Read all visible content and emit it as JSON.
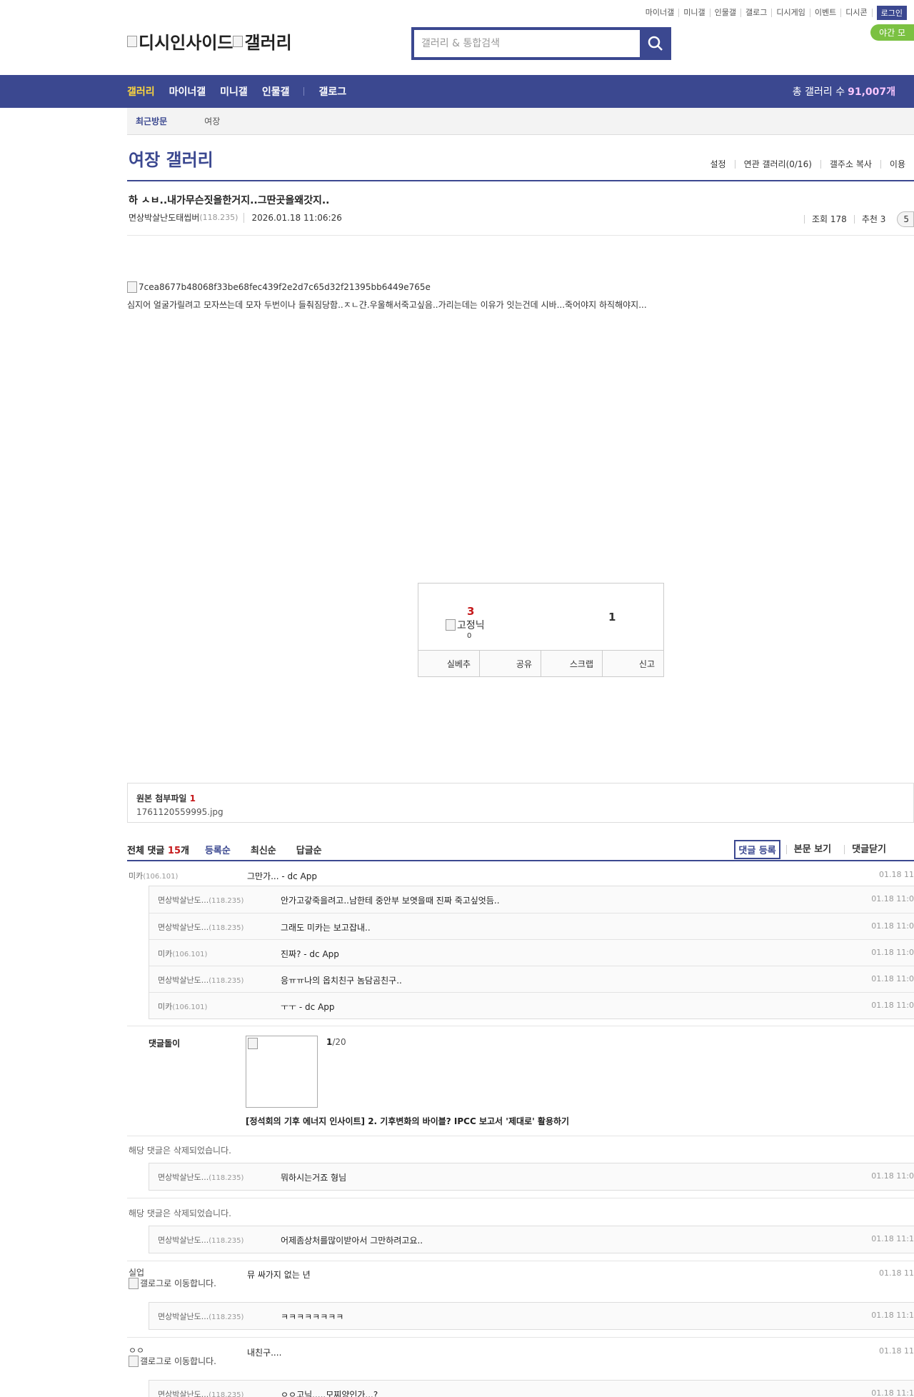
{
  "top_links": [
    "마이너갤",
    "미니갤",
    "인물갤",
    "갤로그",
    "디시게임",
    "이벤트",
    "디시콘"
  ],
  "login_label": "로그인",
  "night_mode_label": "야간 모",
  "logo": {
    "site": "디시인사이드",
    "section": "갤러리"
  },
  "search": {
    "placeholder": "갤러리 & 통합검색"
  },
  "gnb": {
    "items": [
      "갤러리",
      "마이너갤",
      "미니갤",
      "인물갤"
    ],
    "gallog": "갤로그",
    "count_label": "총 갤러리 수",
    "count_value": "91,007개"
  },
  "recent": {
    "label": "최근방문",
    "item": "여장"
  },
  "gallery": {
    "title": "여장 갤러리",
    "options": [
      "설정",
      "연관 갤러리(0/16)",
      "갤주소 복사",
      "이용"
    ]
  },
  "post": {
    "title": "하 ㅅㅂ..내가무슨짓을한거지..그딴곳을왜갓지..",
    "author": "면상박살난도태씹버",
    "ip": "(118.235)",
    "date": "2026.01.18 11:06:26",
    "views": "조회 178",
    "recommend": "추천 3",
    "comment_badge": "5",
    "image_alt": "7cea8677b48068f33be68fec439f2e2d7c65d32f21395bb6449e765e",
    "body": "심지어 얼굴가릴려고 모자쓰는데 모자 두번이나 들춰짐당함..ㅈㄴ갼.우울해서죽고싶음..가리는데는 이유가 잇는건데 시바...죽어야지 하직해야지..."
  },
  "recommend_box": {
    "up_count": "3",
    "fix_label": "고정닉",
    "fix_count": "0",
    "down_count": "1",
    "actions": [
      "실베추",
      "공유",
      "스크랩",
      "신고"
    ]
  },
  "attachment": {
    "label": "원본 첨부파일",
    "count": "1",
    "file": "1761120559995.jpg"
  },
  "comments_header": {
    "total_label": "전체 댓글",
    "total_count": "15",
    "total_unit": "개",
    "sorts": [
      "등록순",
      "최신순",
      "답글순"
    ],
    "register": "댓글 등록",
    "view_post": "본문 보기",
    "close": "댓글닫기"
  },
  "comments": [
    {
      "name": "미카",
      "ip": "(106.101)",
      "msg": "그만가... - dc App",
      "date": "01.18 11"
    },
    {
      "name": "면상박살난도...",
      "ip": "(118.235)",
      "msg": "안가고갛죽을려고..남한테 중안부 보엿을때 진짜 죽고싶엇듬..",
      "date": "01.18 11:0"
    },
    {
      "name": "면상박살난도...",
      "ip": "(118.235)",
      "msg": "그래도 미카는 보고잡내..",
      "date": "01.18 11:0"
    },
    {
      "name": "미카",
      "ip": "(106.101)",
      "msg": "진짜? - dc App",
      "date": "01.18 11:0"
    },
    {
      "name": "면상박살난도...",
      "ip": "(118.235)",
      "msg": "응ㅠㅠ나의 옵치친구 놈담곰친구..",
      "date": "01.18 11:0"
    },
    {
      "name": "미카",
      "ip": "(106.101)",
      "msg": "ㅜㅜ - dc App",
      "date": "01.18 11:0"
    },
    {
      "name": "면상박살난도...",
      "ip": "(118.235)",
      "msg": "뭐하시는거죠 형님",
      "date": "01.18 11:0"
    },
    {
      "name": "면상박살난도...",
      "ip": "(118.235)",
      "msg": "어제좀상처를많이받아서 그만하려고요..",
      "date": "01.18 11:1"
    },
    {
      "name": "실업",
      "msg": "뮤 싸가지 없는 년",
      "date": "01.18 11"
    },
    {
      "name": "면상박살난도...",
      "ip": "(118.235)",
      "msg": "ㅋㅋㅋㅋㅋㅋㅋㅋ",
      "date": "01.18 11:1"
    },
    {
      "name": "ㅇㅇ",
      "msg": "내친구....",
      "date": "01.18 11"
    },
    {
      "name": "면상박살난도...",
      "ip": "(118.235)",
      "msg": "ㅇㅇ고닉.....모찌양인가...?",
      "date": "01.18 11:1"
    }
  ],
  "deleted_comment": "해당 댓글은 삭제되었습니다.",
  "gallcon_alt": "갤로그로 이동합니다.",
  "ad": {
    "label": "댓글돌이",
    "page_current": "1",
    "page_total": "/20",
    "text": "[정석회의 기후 에너지 인사이트] 2. 기후변화의 바이블? IPCC 보고서 '제대로' 활용하기"
  },
  "colors": {
    "brand": "#3b4890",
    "highlight": "#ffd83d",
    "red": "#c5191b",
    "night": "#7bc142"
  }
}
